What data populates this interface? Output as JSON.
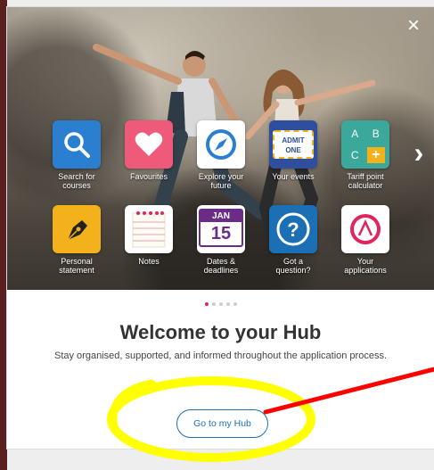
{
  "modal": {
    "close_symbol": "×",
    "next_symbol": "›",
    "tiles": [
      {
        "label": "Search for courses",
        "icon": "search-icon",
        "color": "#2a7fd1"
      },
      {
        "label": "Favourites",
        "icon": "heart-icon",
        "color": "#ef5a7a"
      },
      {
        "label": "Explore your future",
        "icon": "compass-icon",
        "color": "#ffffff"
      },
      {
        "label": "Your events",
        "icon": "admit-one-ticket-icon",
        "color": "#ffffff"
      },
      {
        "label": "Tariff point calculator",
        "icon": "calculator-icon",
        "color": "#3aa89a"
      },
      {
        "label": "Personal statement",
        "icon": "pen-nib-icon",
        "color": "#f3b21b"
      },
      {
        "label": "Notes",
        "icon": "notepad-icon",
        "color": "#ffffff"
      },
      {
        "label": "Dates & deadlines",
        "icon": "calendar-icon",
        "color": "#ffffff"
      },
      {
        "label": "Got a question?",
        "icon": "question-icon",
        "color": "#1b6fb4"
      },
      {
        "label": "Your applications",
        "icon": "applications-logo-icon",
        "color": "#ffffff"
      }
    ],
    "ticket_text_1": "ADMIT",
    "ticket_text_2": "ONE",
    "calendar_month": "JAN",
    "calendar_day": "15",
    "calc_keys": [
      "A",
      "B",
      "C",
      "+"
    ],
    "title": "Welcome to your Hub",
    "subtitle": "Stay organised, supported, and informed throughout the application process.",
    "hub_button": "Go to my Hub",
    "carousel_page": 1,
    "carousel_total": 5
  },
  "annotation_colors": {
    "highlight": "#ffff00",
    "arrow": "#ff0000"
  }
}
